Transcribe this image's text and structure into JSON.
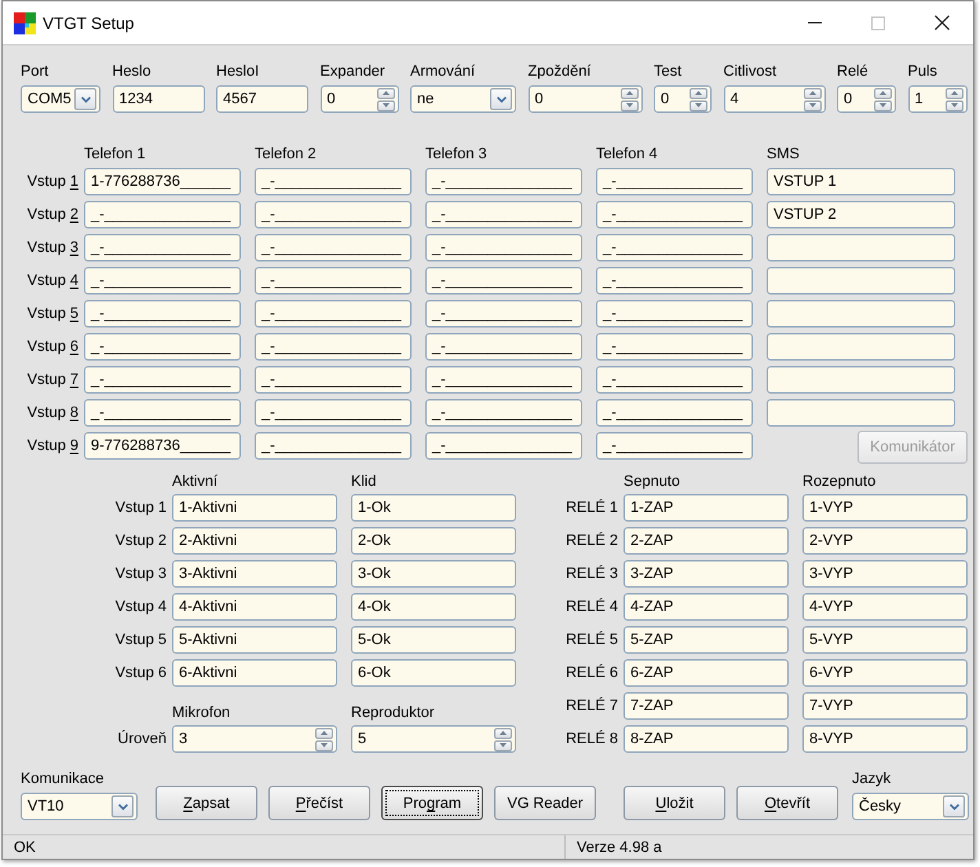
{
  "window": {
    "title": "VTGT Setup",
    "caption_buttons": [
      {
        "kind": "minimize",
        "disabled": false
      },
      {
        "kind": "maximize",
        "disabled": true
      },
      {
        "kind": "close",
        "disabled": false
      }
    ]
  },
  "settings": [
    {
      "label": "Port",
      "kind": "combo",
      "value": "COM5"
    },
    {
      "label": "Heslo",
      "kind": "text",
      "value": "1234"
    },
    {
      "label": "HesloI",
      "kind": "text",
      "value": "4567"
    },
    {
      "label": "Expander",
      "kind": "spin",
      "value": "0"
    },
    {
      "label": "Armování",
      "kind": "combo",
      "value": "ne"
    },
    {
      "label": "Zpoždění",
      "kind": "spin",
      "value": "0"
    },
    {
      "label": "Test",
      "kind": "spin",
      "value": "0"
    },
    {
      "label": "Citlivost",
      "kind": "spin",
      "value": "4"
    },
    {
      "label": "Relé",
      "kind": "spin",
      "value": "0"
    },
    {
      "label": "Puls",
      "kind": "spin",
      "value": "1"
    }
  ],
  "phones": {
    "columns": [
      "Telefon 1",
      "Telefon 2",
      "Telefon 3",
      "Telefon 4"
    ],
    "sms_column": "SMS",
    "rows": [
      {
        "label": [
          {
            "text": "Vstup ",
            "underlined": false
          },
          {
            "text": "1",
            "underlined": true
          }
        ],
        "numbers": [
          "1-776288736______",
          "_-_______________",
          "_-_______________",
          "_-_______________"
        ],
        "sms_field": true,
        "sms": "VSTUP 1"
      },
      {
        "label": [
          {
            "text": "Vstup ",
            "underlined": false
          },
          {
            "text": "2",
            "underlined": true
          }
        ],
        "numbers": [
          "_-_______________",
          "_-_______________",
          "_-_______________",
          "_-_______________"
        ],
        "sms_field": true,
        "sms": "VSTUP 2"
      },
      {
        "label": [
          {
            "text": "Vstup ",
            "underlined": false
          },
          {
            "text": "3",
            "underlined": true
          }
        ],
        "numbers": [
          "_-_______________",
          "_-_______________",
          "_-_______________",
          "_-_______________"
        ],
        "sms_field": true
      },
      {
        "label": [
          {
            "text": "Vstup ",
            "underlined": false
          },
          {
            "text": "4",
            "underlined": true
          }
        ],
        "numbers": [
          "_-_______________",
          "_-_______________",
          "_-_______________",
          "_-_______________"
        ],
        "sms_field": true
      },
      {
        "label": [
          {
            "text": "Vstup ",
            "underlined": false
          },
          {
            "text": "5",
            "underlined": true
          }
        ],
        "numbers": [
          "_-_______________",
          "_-_______________",
          "_-_______________",
          "_-_______________"
        ],
        "sms_field": true
      },
      {
        "label": [
          {
            "text": "Vstup ",
            "underlined": false
          },
          {
            "text": "6",
            "underlined": true
          }
        ],
        "numbers": [
          "_-_______________",
          "_-_______________",
          "_-_______________",
          "_-_______________"
        ],
        "sms_field": true
      },
      {
        "label": [
          {
            "text": "Vstup ",
            "underlined": false
          },
          {
            "text": "7",
            "underlined": true
          }
        ],
        "numbers": [
          "_-_______________",
          "_-_______________",
          "_-_______________",
          "_-_______________"
        ],
        "sms_field": true
      },
      {
        "label": [
          {
            "text": "Vstup ",
            "underlined": false
          },
          {
            "text": "8",
            "underlined": true
          }
        ],
        "numbers": [
          "_-_______________",
          "_-_______________",
          "_-_______________",
          "_-_______________"
        ],
        "sms_field": true
      },
      {
        "label": [
          {
            "text": "Vstup ",
            "underlined": false
          },
          {
            "text": "9",
            "underlined": true
          }
        ],
        "numbers": [
          "9-776288736______",
          "_-_______________",
          "_-_______________",
          "_-_______________"
        ],
        "sms_field": false
      }
    ],
    "komunikator_button": {
      "label": "Komunikátor",
      "disabled": true
    }
  },
  "messages": {
    "columns": [
      "Aktivní",
      "Klid"
    ],
    "rows": [
      {
        "label": "Vstup 1",
        "values": [
          "1-Aktivni",
          "1-Ok"
        ]
      },
      {
        "label": "Vstup 2",
        "values": [
          "2-Aktivni",
          "2-Ok"
        ]
      },
      {
        "label": "Vstup 3",
        "values": [
          "3-Aktivni",
          "3-Ok"
        ]
      },
      {
        "label": "Vstup 4",
        "values": [
          "4-Aktivni",
          "4-Ok"
        ]
      },
      {
        "label": "Vstup 5",
        "values": [
          "5-Aktivni",
          "5-Ok"
        ]
      },
      {
        "label": "Vstup 6",
        "values": [
          "6-Aktivni",
          "6-Ok"
        ]
      }
    ]
  },
  "volume": {
    "columns": [
      "Mikrofon",
      "Reproduktor"
    ],
    "label": "Úroveň",
    "values": [
      "3",
      "5"
    ]
  },
  "relays": {
    "columns": [
      "Sepnuto",
      "Rozepnuto"
    ],
    "rows": [
      {
        "label": "RELÉ 1",
        "values": [
          "1-ZAP",
          "1-VYP"
        ]
      },
      {
        "label": "RELÉ 2",
        "values": [
          "2-ZAP",
          "2-VYP"
        ]
      },
      {
        "label": "RELÉ 3",
        "values": [
          "3-ZAP",
          "3-VYP"
        ]
      },
      {
        "label": "RELÉ 4",
        "values": [
          "4-ZAP",
          "4-VYP"
        ]
      },
      {
        "label": "RELÉ 5",
        "values": [
          "5-ZAP",
          "5-VYP"
        ]
      },
      {
        "label": "RELÉ 6",
        "values": [
          "6-ZAP",
          "6-VYP"
        ]
      },
      {
        "label": "RELÉ 7",
        "values": [
          "7-ZAP",
          "7-VYP"
        ]
      },
      {
        "label": "RELÉ 8",
        "values": [
          "8-ZAP",
          "8-VYP"
        ]
      }
    ]
  },
  "communication": {
    "label": "Komunikace",
    "value": "VT10"
  },
  "buttons": [
    {
      "label": [
        {
          "text": "Z",
          "underlined": true
        },
        {
          "text": "apsat",
          "underlined": false
        }
      ],
      "focused": false
    },
    {
      "label": [
        {
          "text": "P",
          "underlined": true
        },
        {
          "text": "řečíst",
          "underlined": false
        }
      ],
      "focused": false
    },
    {
      "label": [
        {
          "text": "Pro",
          "underlined": false
        },
        {
          "text": "g",
          "underlined": true
        },
        {
          "text": "ram",
          "underlined": false
        }
      ],
      "focused": true
    },
    {
      "label": [
        {
          "text": "VG Reader",
          "underlined": false
        }
      ],
      "focused": false
    },
    {
      "label": [
        {
          "text": "U",
          "underlined": true
        },
        {
          "text": "ložit",
          "underlined": false
        }
      ],
      "focused": false
    },
    {
      "label": [
        {
          "text": "O",
          "underlined": true
        },
        {
          "text": "tevřít",
          "underlined": false
        }
      ],
      "focused": false
    }
  ],
  "language": {
    "label": "Jazyk",
    "value": "Česky"
  },
  "status_bar": {
    "message": "OK",
    "version": "Verze 4.98 a"
  }
}
